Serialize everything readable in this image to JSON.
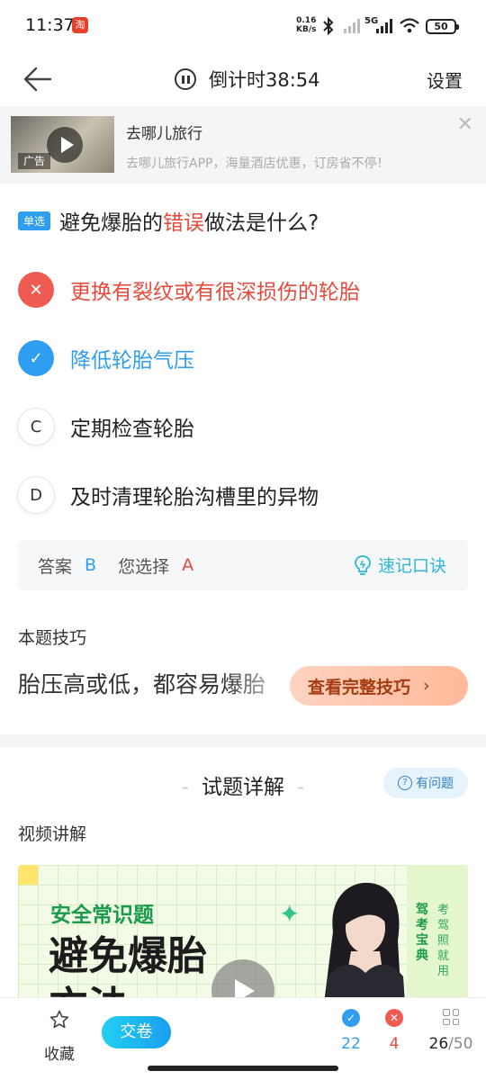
{
  "status_bar": {
    "time": "11:37",
    "app_badge": "淘",
    "net_speed_top": "0.16",
    "net_speed_unit": "KB/s",
    "network": "5G",
    "battery": "50"
  },
  "nav": {
    "timer_label": "倒计时38:54",
    "settings_label": "设置"
  },
  "ad": {
    "title": "去哪儿旅行",
    "description": "去哪儿旅行APP，海量酒店优惠，订房省不停！",
    "tag": "广告"
  },
  "question": {
    "type_tag": "单选",
    "text_before": "避免爆胎的",
    "text_highlight": "错误",
    "text_after": "做法是什么?",
    "options": [
      {
        "marker": "✕",
        "text": "更换有裂纹或有很深损伤的轮胎",
        "state": "wrong"
      },
      {
        "marker": "✓",
        "text": "降低轮胎气压",
        "state": "correct"
      },
      {
        "marker": "C",
        "text": "定期检查轮胎",
        "state": "normal"
      },
      {
        "marker": "D",
        "text": "及时清理轮胎沟槽里的异物",
        "state": "normal"
      }
    ]
  },
  "answer": {
    "answer_label": "答案",
    "answer_value": "B",
    "choice_label": "您选择",
    "choice_value": "A",
    "memo_label": "速记口诀"
  },
  "tips": {
    "title": "本题技巧",
    "preview": "胎压高或低，都容易爆胎",
    "button": "查看完整技巧"
  },
  "detail": {
    "title": "试题详解",
    "ask_button": "有问题",
    "video_label": "视频讲解",
    "video": {
      "subtitle": "安全常识题",
      "title_line1": "避免爆胎",
      "title_line2": "方法",
      "brand": "驾考宝典",
      "slogan": "考驾照就用"
    }
  },
  "bottom": {
    "favorite_label": "收藏",
    "submit_label": "交卷",
    "correct_count": "22",
    "wrong_count": "4",
    "progress_current": "26",
    "progress_total": "/50"
  },
  "colors": {
    "accent_blue": "#2f9ef0",
    "error_red": "#e84a3c",
    "memo_cyan": "#2fb6d6"
  }
}
